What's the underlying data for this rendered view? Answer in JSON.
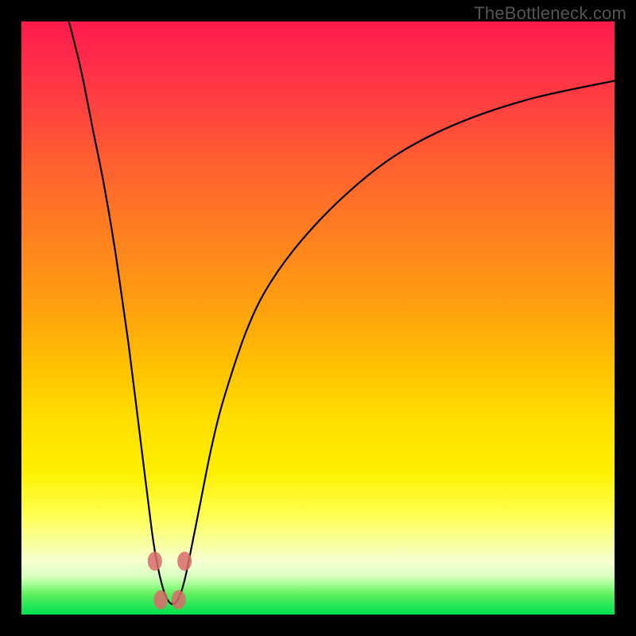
{
  "watermark": "TheBottleneck.com",
  "chart_data": {
    "type": "line",
    "title": "",
    "xlabel": "",
    "ylabel": "",
    "xlim": [
      0,
      100
    ],
    "ylim": [
      0,
      100
    ],
    "grid": false,
    "curve": {
      "x": [
        8,
        10,
        12,
        14,
        16,
        18,
        20,
        22,
        23,
        24,
        25,
        26,
        27,
        28,
        30,
        32,
        34,
        38,
        42,
        48,
        56,
        64,
        74,
        86,
        100
      ],
      "y": [
        100,
        92,
        82,
        72,
        60,
        46,
        30,
        14,
        8,
        4,
        2,
        2,
        4,
        8,
        18,
        28,
        36,
        48,
        56,
        64,
        72,
        78,
        83,
        87,
        90
      ]
    },
    "markers": {
      "x": [
        22.5,
        27.5,
        23.5,
        26.5
      ],
      "y": [
        9,
        9,
        2.5,
        2.5
      ]
    },
    "colors": {
      "curve": "#000000",
      "marker": "#d96b6b",
      "gradient_top": "#ff1a4d",
      "gradient_bottom": "#00e050"
    }
  }
}
